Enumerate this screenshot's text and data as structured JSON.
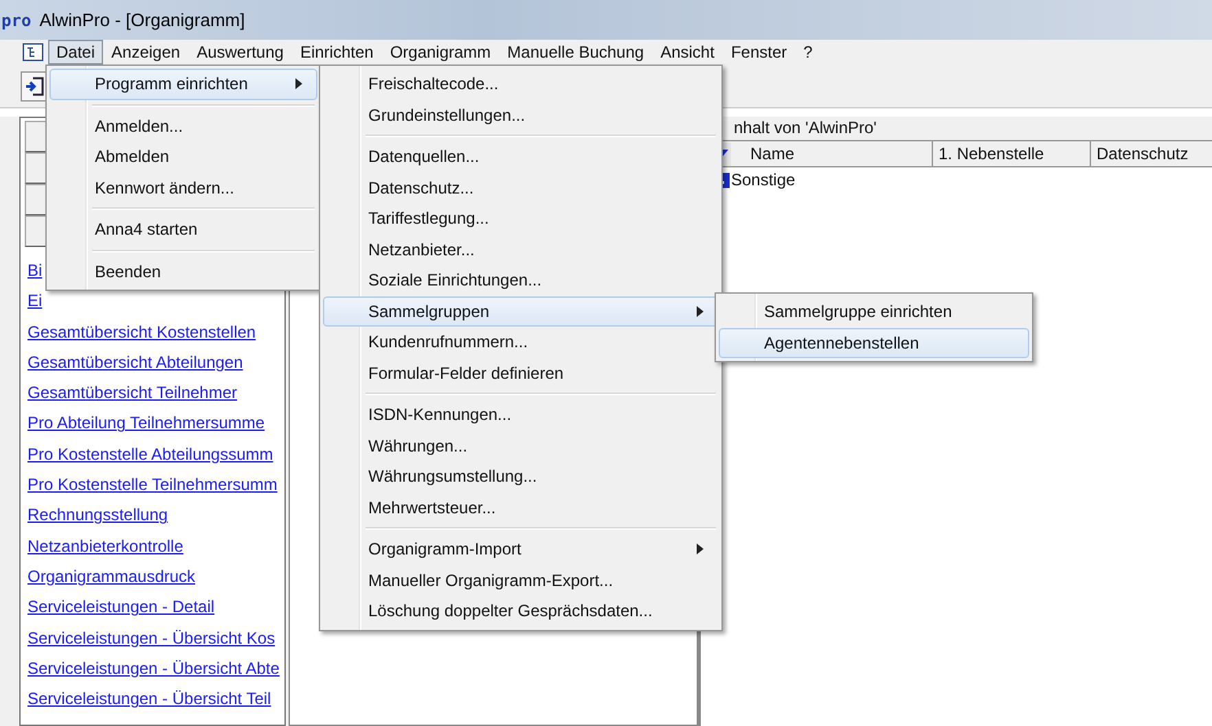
{
  "window": {
    "logo": "pro",
    "title": "AlwinPro - [Organigramm]"
  },
  "menubar": [
    {
      "label": "Datei",
      "selected": true
    },
    {
      "label": "Anzeigen",
      "selected": false
    },
    {
      "label": "Auswertung",
      "selected": false
    },
    {
      "label": "Einrichten",
      "selected": false
    },
    {
      "label": "Organigramm",
      "selected": false
    },
    {
      "label": "Manuelle Buchung",
      "selected": false
    },
    {
      "label": "Ansicht",
      "selected": false
    },
    {
      "label": "Fenster",
      "selected": false
    },
    {
      "label": "?",
      "selected": false
    }
  ],
  "left_panel": {
    "links": [
      "Bi",
      "Ei",
      "Gesamtübersicht  Kostenstellen",
      "Gesamtübersicht Abteilungen",
      "Gesamtübersicht Teilnehmer",
      "Pro Abteilung Teilnehmersumme",
      "Pro Kostenstelle Abteilungssumm",
      "Pro Kostenstelle Teilnehmersumm",
      "Rechnungsstellung",
      "Netzanbieterkontrolle",
      "Organigrammausdruck",
      "Serviceleistungen - Detail",
      "Serviceleistungen - Übersicht  Kos",
      "Serviceleistungen - Übersicht Abte",
      "Serviceleistungen - Übersicht Teil"
    ]
  },
  "right_panel": {
    "header": "nhalt von 'AlwinPro'",
    "columns": [
      "Name",
      "1. Nebenstelle",
      "Datenschutz"
    ],
    "rows": [
      {
        "name": "Sonstige"
      }
    ]
  },
  "menus": [
    {
      "items": [
        {
          "kind": "item",
          "label": "Programm einrichten",
          "selected": true,
          "submenu": true
        },
        {
          "kind": "separator"
        },
        {
          "kind": "item",
          "label": "Anmelden...",
          "selected": false,
          "submenu": false
        },
        {
          "kind": "item",
          "label": "Abmelden",
          "selected": false,
          "submenu": false
        },
        {
          "kind": "item",
          "label": "Kennwort ändern...",
          "selected": false,
          "submenu": false
        },
        {
          "kind": "separator"
        },
        {
          "kind": "item",
          "label": "Anna4 starten",
          "selected": false,
          "submenu": false
        },
        {
          "kind": "separator"
        },
        {
          "kind": "item",
          "label": "Beenden",
          "selected": false,
          "submenu": false
        }
      ]
    },
    {
      "items": [
        {
          "kind": "item",
          "label": "Freischaltecode...",
          "selected": false,
          "submenu": false
        },
        {
          "kind": "item",
          "label": "Grundeinstellungen...",
          "selected": false,
          "submenu": false
        },
        {
          "kind": "separator"
        },
        {
          "kind": "item",
          "label": "Datenquellen...",
          "selected": false,
          "submenu": false
        },
        {
          "kind": "item",
          "label": "Datenschutz...",
          "selected": false,
          "submenu": false
        },
        {
          "kind": "item",
          "label": "Tariffestlegung...",
          "selected": false,
          "submenu": false
        },
        {
          "kind": "item",
          "label": "Netzanbieter...",
          "selected": false,
          "submenu": false
        },
        {
          "kind": "item",
          "label": "Soziale Einrichtungen...",
          "selected": false,
          "submenu": false
        },
        {
          "kind": "item",
          "label": "Sammelgruppen",
          "selected": true,
          "submenu": true
        },
        {
          "kind": "item",
          "label": "Kundenrufnummern...",
          "selected": false,
          "submenu": false
        },
        {
          "kind": "item",
          "label": "Formular-Felder definieren",
          "selected": false,
          "submenu": false
        },
        {
          "kind": "separator"
        },
        {
          "kind": "item",
          "label": "ISDN-Kennungen...",
          "selected": false,
          "submenu": false
        },
        {
          "kind": "item",
          "label": "Währungen...",
          "selected": false,
          "submenu": false
        },
        {
          "kind": "item",
          "label": "Währungsumstellung...",
          "selected": false,
          "submenu": false
        },
        {
          "kind": "item",
          "label": "Mehrwertsteuer...",
          "selected": false,
          "submenu": false
        },
        {
          "kind": "separator"
        },
        {
          "kind": "item",
          "label": "Organigramm-Import",
          "selected": false,
          "submenu": true
        },
        {
          "kind": "item",
          "label": "Manueller Organigramm-Export...",
          "selected": false,
          "submenu": false
        },
        {
          "kind": "item",
          "label": "Löschung doppelter Gesprächsdaten...",
          "selected": false,
          "submenu": false
        }
      ]
    },
    {
      "items": [
        {
          "kind": "item",
          "label": "Sammelgruppe einrichten",
          "selected": false,
          "submenu": false
        },
        {
          "kind": "item",
          "label": "Agentennebenstellen",
          "selected": true,
          "submenu": false
        }
      ]
    }
  ]
}
